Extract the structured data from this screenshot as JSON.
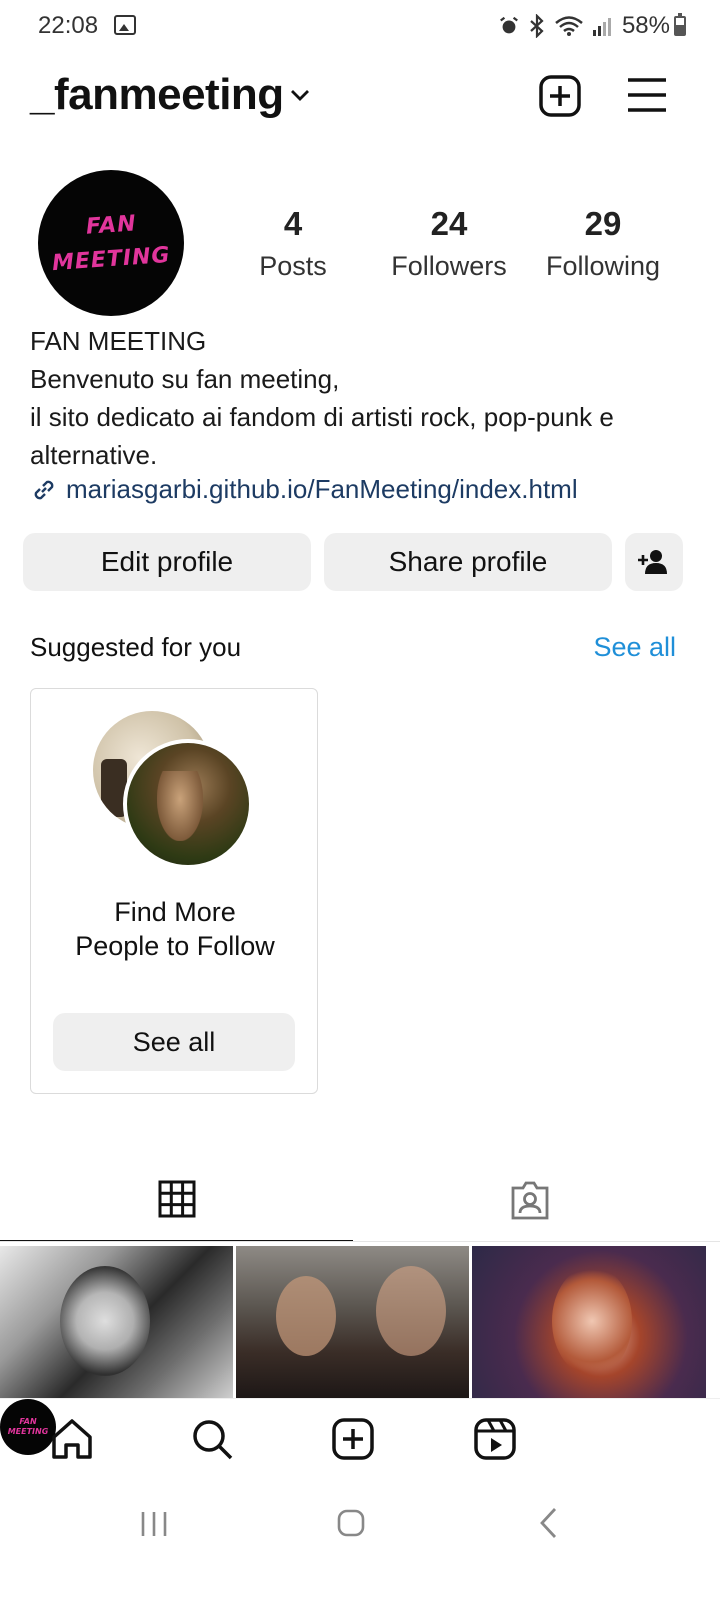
{
  "status_bar": {
    "time": "22:08",
    "battery": "58%",
    "icons": [
      "gallery-icon",
      "alarm-icon",
      "bluetooth-icon",
      "wifi-icon",
      "signal-icon",
      "battery-icon"
    ]
  },
  "header": {
    "username": "_fanmeeting"
  },
  "profile": {
    "avatar_text_line1": "FAN",
    "avatar_text_line2": "MEETING",
    "avatar_text_color": "#e1359c",
    "stats": {
      "posts_count": "4",
      "posts_label": "Posts",
      "followers_count": "24",
      "followers_label": "Followers",
      "following_count": "29",
      "following_label": "Following"
    },
    "display_name": "FAN MEETING",
    "bio_line1": "Benvenuto su fan meeting,",
    "bio_line2": "il sito dedicato ai fandom di artisti rock, pop-punk e alternative.",
    "link": "mariasgarbi.github.io/FanMeeting/index.html"
  },
  "actions": {
    "edit_label": "Edit profile",
    "share_label": "Share profile"
  },
  "suggested": {
    "title": "Suggested for you",
    "see_all_label": "See all",
    "card_text_line1": "Find More",
    "card_text_line2": "People to Follow",
    "card_button_label": "See all"
  },
  "colors": {
    "accent_link": "#1f8fd8",
    "button_bg": "#efefef",
    "bio_link": "#1d3b63"
  }
}
